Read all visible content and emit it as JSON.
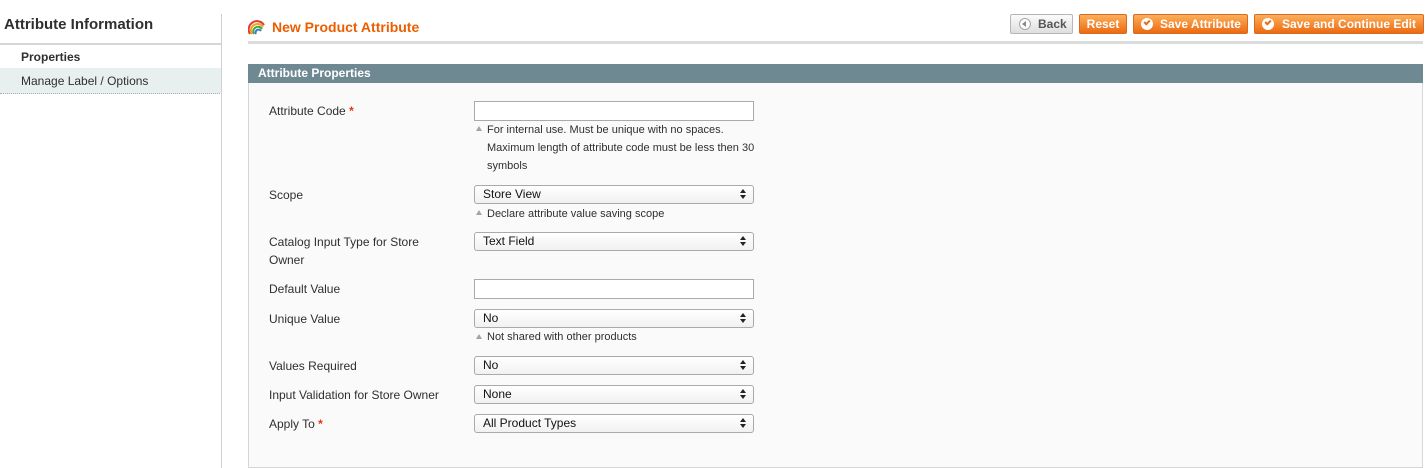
{
  "sidebar": {
    "title": "Attribute Information",
    "tabs": [
      {
        "label": "Properties",
        "active": true
      },
      {
        "label": "Manage Label / Options",
        "active": false
      }
    ]
  },
  "header": {
    "title": "New Product Attribute",
    "icon": "rainbow-icon",
    "buttons": {
      "back": "Back",
      "reset": "Reset",
      "save": "Save Attribute",
      "save_continue": "Save and Continue Edit"
    }
  },
  "colors": {
    "accent": "#eb5e00",
    "button_orange": "#ec6a12",
    "fieldset_header": "#6f8992",
    "required": "#eb340a"
  },
  "fieldset": {
    "title": "Attribute Properties",
    "fields": {
      "attribute_code": {
        "label": "Attribute Code",
        "required": "*",
        "value": "",
        "note_lines": [
          "For internal use. Must be unique with no spaces.",
          "Maximum length of attribute code must be less then 30",
          "symbols"
        ]
      },
      "scope": {
        "label": "Scope",
        "value": "Store View",
        "note": "Declare attribute value saving scope"
      },
      "input_type": {
        "label_line1": "Catalog Input Type for Store",
        "label_line2": "Owner",
        "value": "Text Field"
      },
      "default_value": {
        "label": "Default Value",
        "value": ""
      },
      "unique_value": {
        "label": "Unique Value",
        "value": "No",
        "note": "Not shared with other products"
      },
      "values_required": {
        "label": "Values Required",
        "value": "No"
      },
      "input_validation": {
        "label": "Input Validation for Store Owner",
        "value": "None"
      },
      "apply_to": {
        "label": "Apply To",
        "required": "*",
        "value": "All Product Types"
      }
    }
  }
}
